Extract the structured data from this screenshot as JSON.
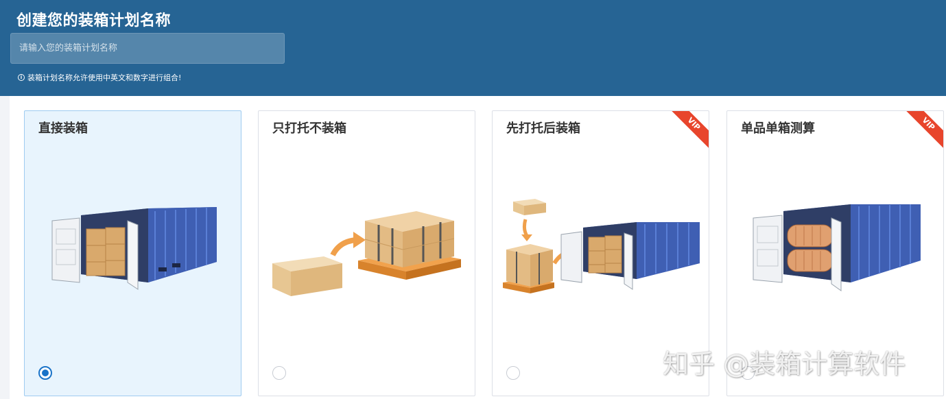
{
  "header": {
    "title": "创建您的装箱计划名称",
    "input_placeholder": "请输入您的装箱计划名称",
    "input_value": "",
    "hint": "装箱计划名称允许使用中英文和数字进行组合!"
  },
  "cards": [
    {
      "title": "直接装箱",
      "selected": true,
      "vip": false,
      "illustration": "container-with-boxes"
    },
    {
      "title": "只打托不装箱",
      "selected": false,
      "vip": false,
      "illustration": "box-to-pallet"
    },
    {
      "title": "先打托后装箱",
      "selected": false,
      "vip": true,
      "illustration": "pallet-to-container"
    },
    {
      "title": "单品单箱测算",
      "selected": false,
      "vip": true,
      "illustration": "container-with-rolls"
    }
  ],
  "vip_label": "VIP",
  "watermark": "知乎 @装箱计算软件",
  "colors": {
    "header_bg": "#266494",
    "selected_bg": "#e8f4fd",
    "radio_accent": "#1a73c8",
    "vip_ribbon": "#e8452c",
    "container_blue": "#4a6dc4"
  }
}
